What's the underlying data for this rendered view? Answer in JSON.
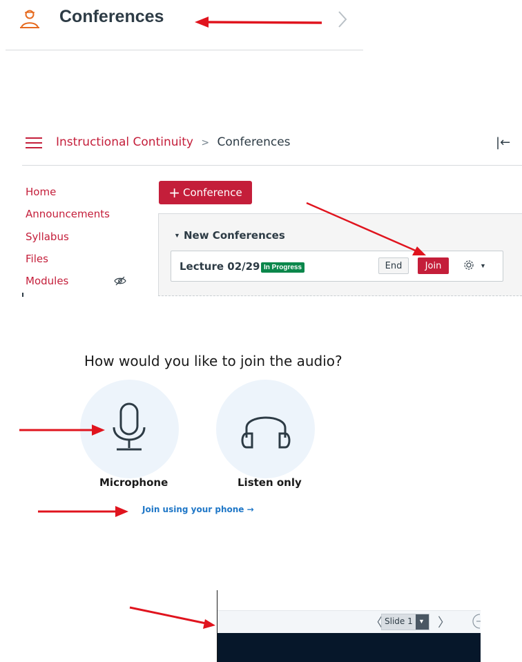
{
  "section1": {
    "title": "Conferences",
    "icon": "person-presenting-icon",
    "chevron": "chevron-right-icon"
  },
  "section2": {
    "breadcrumb": {
      "course": "Instructional Continuity",
      "separator": ">",
      "current": "Conferences"
    },
    "collapse_glyph": "|←",
    "nav": [
      "Home",
      "Announcements",
      "Syllabus",
      "Files",
      "Modules"
    ],
    "add_conference_label": "Conference",
    "section_heading": "New Conferences",
    "conference": {
      "title": "Lecture 02/29",
      "status": "In Progress",
      "end_label": "End",
      "join_label": "Join"
    }
  },
  "section3": {
    "question": "How would you like to join the audio?",
    "microphone_label": "Microphone",
    "listen_label": "Listen only",
    "phone_link": "Join using your phone →"
  },
  "section4": {
    "slide_label": "Slide 1",
    "prev_glyph": "〈",
    "next_glyph": "〉"
  },
  "colors": {
    "brand": "#c41e3a",
    "status_green": "#0b874b",
    "link_blue": "#1f77c7",
    "arrow_red": "#e0141e"
  }
}
